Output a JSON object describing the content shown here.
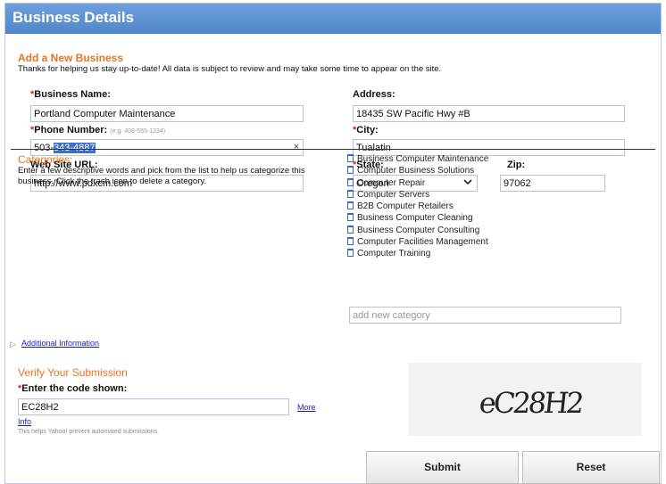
{
  "window": {
    "title": "Business Details"
  },
  "form": {
    "section_title": "Add a New Business",
    "intro": "Thanks for helping us stay up-to-date! All data is subject to review and may take some time to appear on the site.",
    "business_name": {
      "label": "Business Name:",
      "value": "Portland Computer Maintenance"
    },
    "phone": {
      "label": "Phone Number:",
      "hint": "(e.g. 408-555-1234)",
      "value_prefix": "503-",
      "value_selected": "343-4887",
      "clear_glyph": "×"
    },
    "website": {
      "label": "Web Site URL:",
      "value": "http://www.pdxcm.com"
    },
    "address": {
      "label": "Address:",
      "value": "18435 SW Pacific Hwy #B"
    },
    "city": {
      "label": "City:",
      "value": "Tualatin"
    },
    "state": {
      "label": "State:",
      "value": "Oregon",
      "chevron": "chevron-down-icon"
    },
    "zip": {
      "label": "Zip:",
      "value": "97062"
    },
    "required_mark": "*"
  },
  "categories": {
    "title": "Categories:",
    "help": "Enter a few descriptive words and pick from the list to help us categorize this business. Click the trash icon to delete a category.",
    "items": [
      "Business Computer Maintenance",
      "Computer Business Solutions",
      "Computer Repair",
      "Computer Servers",
      "B2B Computer Retailers",
      "Business Computer Cleaning",
      "Business Computer Consulting",
      "Computer Facilities Management",
      "Computer Training"
    ],
    "add_placeholder": "add new category"
  },
  "additional": {
    "arrow": "▷",
    "link": "Additional Information"
  },
  "verify": {
    "title": "Verify Your Submission",
    "label": "Enter the code shown:",
    "value": "EC28H2",
    "more": "More",
    "info": "Info",
    "note": "This helps Yahoo! prevent automated submissions.",
    "captcha_text": "eC28H2"
  },
  "buttons": {
    "submit": "Submit",
    "reset": "Reset"
  },
  "colors": {
    "titlebar": "#4f86c9",
    "accent": "#e8741e",
    "required": "#d9251d",
    "link": "#1a1ad4"
  }
}
